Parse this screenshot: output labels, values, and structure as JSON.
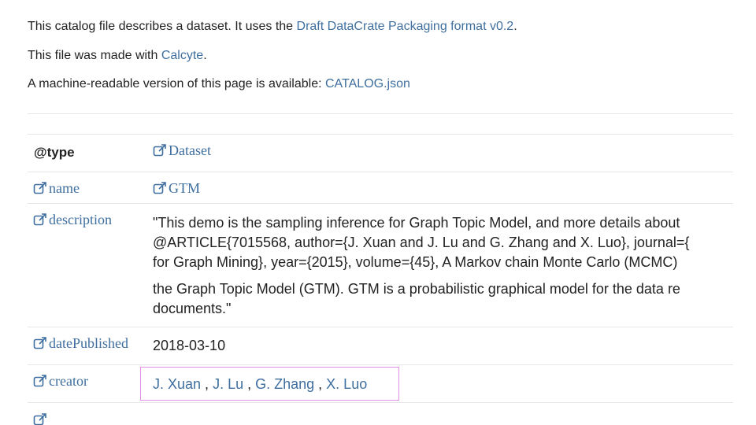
{
  "intro": {
    "line1_prefix": "This catalog file describes a dataset. It uses the ",
    "line1_link": "Draft DataCrate Packaging format v0.2",
    "line1_suffix": ".",
    "line2_prefix": "This file was made with ",
    "line2_link": "Calcyte",
    "line2_suffix": ".",
    "line3_prefix": "A machine-readable version of this page is available: ",
    "line3_link": "CATALOG.json"
  },
  "table": {
    "type_key": "@type",
    "type_value": "Dataset",
    "name_key": "name",
    "name_value": "GTM",
    "description_key": "description",
    "description_lines": [
      "\"This demo is the sampling inference for Graph Topic Model, and more details about",
      "@ARTICLE{7015568, author={J. Xuan and J. Lu and G. Zhang and X. Luo}, journal={",
      "for Graph Mining}, year={2015}, volume={45}, A Markov chain Monte Carlo (MCMC)",
      "the Graph Topic Model (GTM). GTM is a probabilistic graphical model for the data re",
      "documents.\""
    ],
    "date_key": "datePublished",
    "date_value": "2018-03-10",
    "creator_key": "creator",
    "creators": [
      "J. Xuan",
      "J. Lu",
      "G. Zhang",
      "X. Luo"
    ],
    "creator_separator": " , "
  },
  "icons": {
    "external_link": "external-link-icon"
  },
  "colors": {
    "link": "#3f6f9f",
    "highlight_border": "#e28fe6",
    "rule": "#e6e6e6"
  }
}
